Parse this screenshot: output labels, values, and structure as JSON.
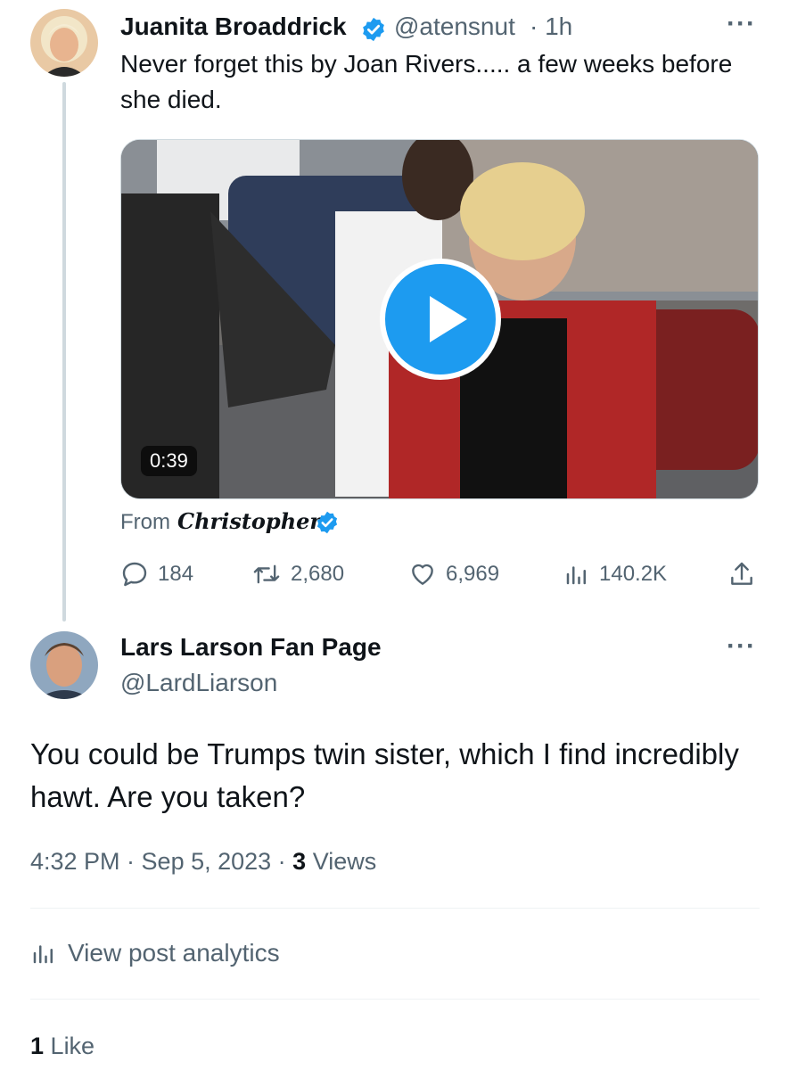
{
  "quoted_tweet": {
    "author_name": "Juanita Broaddrick",
    "author_handle": "@atensnut",
    "time": "· 1h",
    "text": "Never forget this by Joan Rivers..... a few weeks before she died.",
    "video_duration": "0:39",
    "from_label": "From",
    "from_name": "Christopher",
    "stats": {
      "replies": "184",
      "reposts": "2,680",
      "likes": "6,969",
      "views": "140.2K"
    }
  },
  "reply_tweet": {
    "author_name": "Lars Larson Fan Page",
    "author_handle": "@LardLiarson",
    "text": "You could be Trumps twin sister, which I find incredibly hawt.  Are you taken?",
    "timestamp": "4:32 PM · Sep 5, 2023 · ",
    "views_count": "3",
    "views_label": "Views",
    "analytics_label": "View post analytics",
    "likes_count": "1",
    "likes_label": "Like"
  },
  "colors": {
    "accent": "#1d9bf0",
    "secondary_text": "#536471",
    "primary_text": "#0f1419"
  }
}
